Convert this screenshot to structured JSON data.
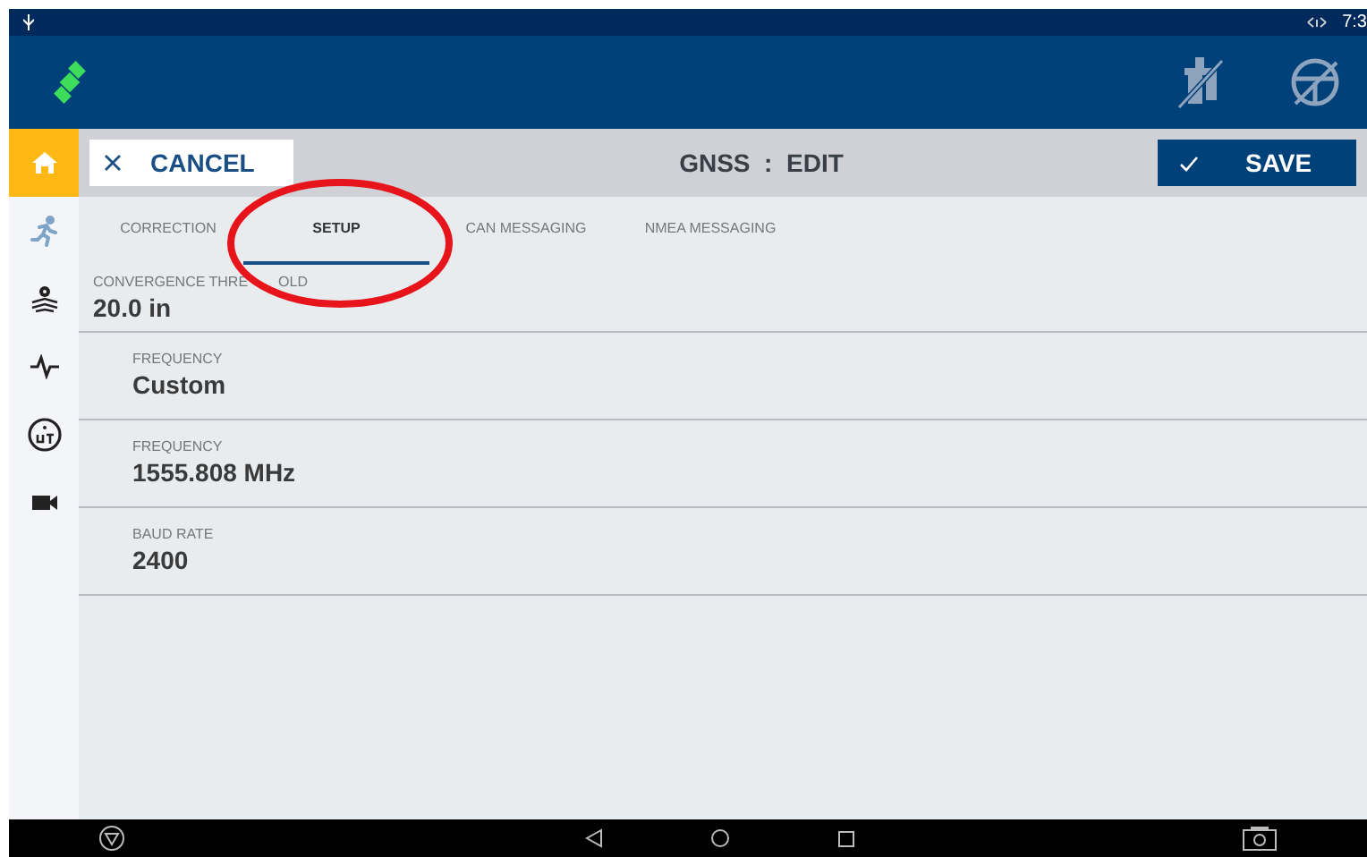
{
  "status_bar": {
    "time": "7:3"
  },
  "toolbar": {
    "cancel": "CANCEL",
    "title": "GNSS  :  EDIT",
    "save": "SAVE"
  },
  "sidebar": {
    "items": [
      {
        "kind": "home",
        "selected": true
      },
      {
        "kind": "runner",
        "selected": false
      },
      {
        "kind": "gear-layers",
        "selected": false
      },
      {
        "kind": "pulse",
        "selected": false
      },
      {
        "kind": "ut",
        "selected": false
      },
      {
        "kind": "camera",
        "selected": false
      }
    ]
  },
  "tabs": [
    {
      "label": "CORRECTION",
      "selected": false
    },
    {
      "label": "SETUP",
      "selected": true
    },
    {
      "label": "CAN MESSAGING",
      "selected": false
    },
    {
      "label": "NMEA MESSAGING",
      "selected": false
    }
  ],
  "fields": [
    {
      "label": "CONVERGENCE THRE",
      "label_tail": "OLD",
      "value": "20.0 in"
    },
    {
      "label": "FREQUENCY",
      "value": "Custom"
    },
    {
      "label": "FREQUENCY",
      "value": "1555.808 MHz"
    },
    {
      "label": "BAUD RATE",
      "value": "2400"
    }
  ],
  "annotation": {
    "kind": "ellipse",
    "color": "#e8141b"
  }
}
